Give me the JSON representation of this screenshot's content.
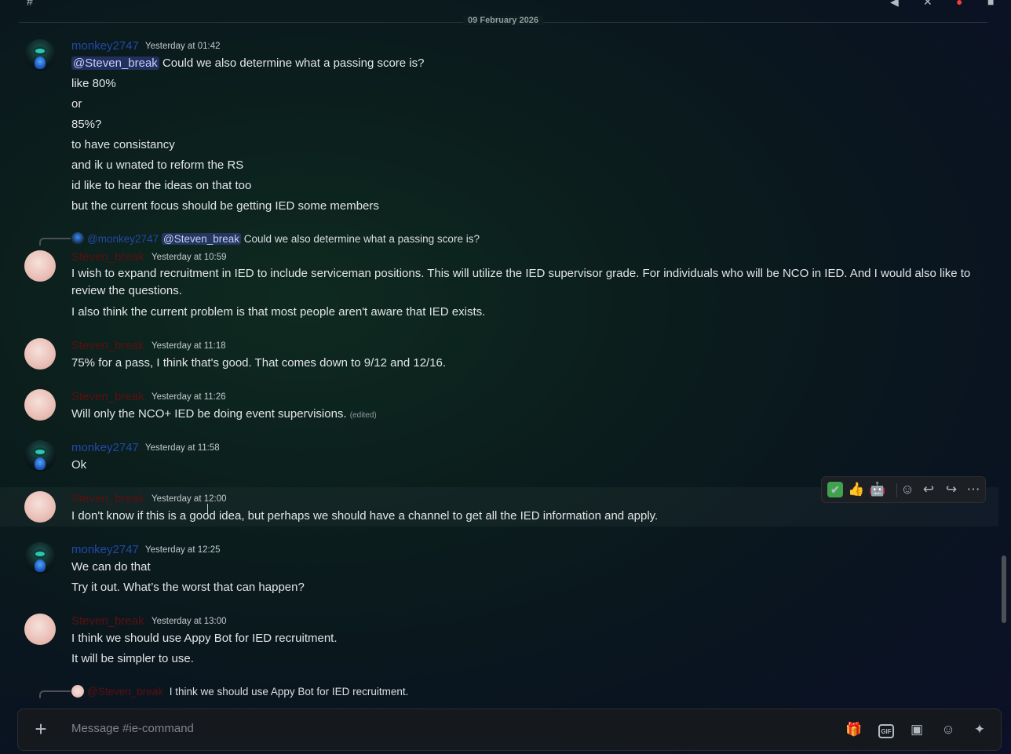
{
  "date_divider": "09 February 2026",
  "users": {
    "monkey": "monkey2747",
    "steven": "Steven_break"
  },
  "messages": [
    {
      "author": "monkey2747",
      "timestamp": "Yesterday at 01:42",
      "mention": "@Steven_break",
      "lines": [
        "Could we also determine what a passing score is?",
        "like 80%",
        "or",
        "85%?",
        "to have consistancy",
        "and ik u wnated to reform the RS",
        "id like to hear the ideas on that too",
        "but the current focus should be getting IED some members"
      ]
    },
    {
      "author": "Steven_break",
      "timestamp": "Yesterday at 10:59",
      "reply": {
        "author": "@monkey2747",
        "mention": "@Steven_break",
        "text": "Could we also determine what a passing score is?"
      },
      "lines": [
        "I wish to expand recruitment in IED to include serviceman positions. This will utilize the IED supervisor grade. For individuals who will be NCO in IED.  And I would also like to review the questions.",
        "I also think the current problem is that most people aren't aware that IED exists."
      ]
    },
    {
      "author": "Steven_break",
      "timestamp": "Yesterday at 11:18",
      "lines": [
        "75% for a pass, I think that's good. That comes down to 9/12 and 12/16."
      ]
    },
    {
      "author": "Steven_break",
      "timestamp": "Yesterday at 11:26",
      "lines": [
        "Will only the NCO+ IED be doing event supervisions."
      ],
      "edited": "(edited)"
    },
    {
      "author": "monkey2747",
      "timestamp": "Yesterday at 11:58",
      "lines": [
        "Ok"
      ]
    },
    {
      "author": "Steven_break",
      "timestamp": "Yesterday at 12:00",
      "lines": [
        "I don't know if this is a good idea, but perhaps we should have a channel to get all the IED information and apply."
      ]
    },
    {
      "author": "monkey2747",
      "timestamp": "Yesterday at 12:25",
      "lines": [
        "We can do that",
        "Try it out. What’s the worst that can happen?"
      ]
    },
    {
      "author": "Steven_break",
      "timestamp": "Yesterday at 13:00",
      "lines": [
        "I think we should use Appy Bot for IED recruitment.",
        "It will be simpler to use."
      ]
    },
    {
      "reply": {
        "author": "@Steven_break",
        "text": "I think we should use Appy Bot for IED recruitment."
      }
    }
  ],
  "message_toolbar": {
    "icons": [
      "check-reaction",
      "thumbs-up-reaction",
      "custom-emoji-reaction",
      "add-reaction",
      "reply",
      "forward",
      "more"
    ],
    "glyphs": {
      "check": "✔",
      "thumbs": "👍",
      "custom": "🤖",
      "emoji": "☺",
      "reply": "↩",
      "forward": "↪",
      "more": "⋯"
    }
  },
  "composer": {
    "placeholder": "Message #ie-command",
    "plus": "+",
    "gif_label": "GIF",
    "icons": [
      "gift-icon",
      "gif-icon",
      "sticker-icon",
      "emoji-icon",
      "apps-icon"
    ],
    "glyphs": {
      "gift": "🎁",
      "sticker": "▣",
      "emoji": "☺",
      "apps": "✦"
    }
  },
  "colors": {
    "monkey_name": "#1f4aa8",
    "steven_name": "#5a1010",
    "accent": "#5865f2"
  }
}
